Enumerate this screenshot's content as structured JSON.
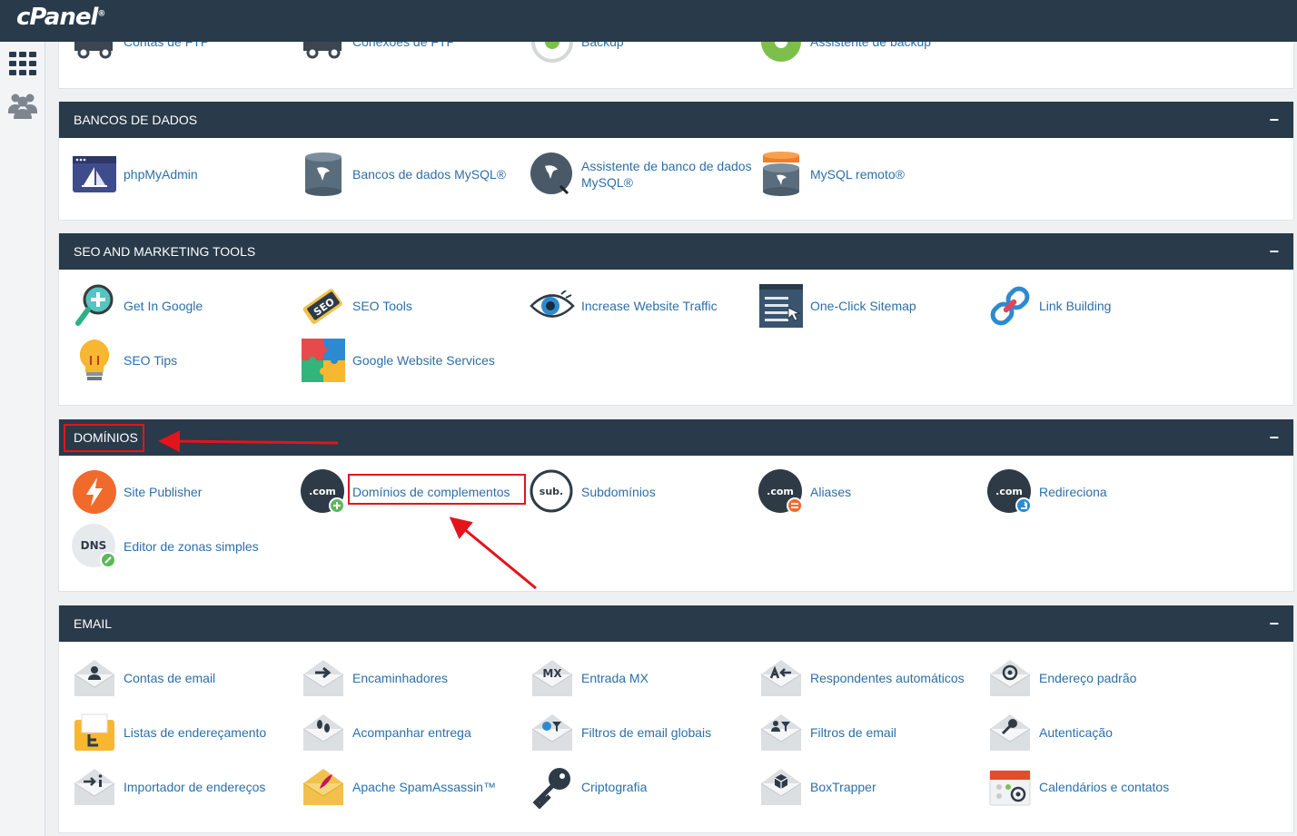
{
  "app": {
    "logo": "cPanel",
    "logo_mark": "®"
  },
  "sidebar": {
    "items": [
      {
        "icon": "grid-icon"
      },
      {
        "icon": "users-icon"
      }
    ]
  },
  "files_panel_partial": {
    "items": [
      {
        "label": "Contas de FTP",
        "icon": "ftp-truck-icon"
      },
      {
        "label": "Conexões de FTP",
        "icon": "ftp-connections-icon"
      },
      {
        "label": "Backup",
        "icon": "backup-icon"
      },
      {
        "label": "Assistente de backup",
        "icon": "backup-wizard-icon"
      }
    ]
  },
  "databases": {
    "title": "BANCOS DE DADOS",
    "collapse": "−",
    "items": [
      {
        "label": "phpMyAdmin",
        "icon": "phpmyadmin-icon"
      },
      {
        "label": "Bancos de dados MySQL®",
        "icon": "mysql-database-icon"
      },
      {
        "label": "Assistente de banco de dados MySQL®",
        "icon": "mysql-wizard-icon"
      },
      {
        "label": "MySQL remoto®",
        "icon": "remote-mysql-icon"
      }
    ]
  },
  "seo": {
    "title": "SEO AND MARKETING TOOLS",
    "collapse": "−",
    "items": [
      {
        "label": "Get In Google",
        "icon": "get-in-google-icon"
      },
      {
        "label": "SEO Tools",
        "icon": "seo-tag-icon"
      },
      {
        "label": "Increase Website Traffic",
        "icon": "eye-icon"
      },
      {
        "label": "One-Click Sitemap",
        "icon": "sitemap-icon"
      },
      {
        "label": "Link Building",
        "icon": "link-icon"
      },
      {
        "label": "SEO Tips",
        "icon": "lightbulb-icon"
      },
      {
        "label": "Google Website Services",
        "icon": "puzzle-icon"
      }
    ]
  },
  "domains": {
    "title": "DOMÍNIOS",
    "collapse": "−",
    "items": [
      {
        "label": "Site Publisher",
        "icon": "site-publisher-icon"
      },
      {
        "label": "Domínios de complementos",
        "icon": "addon-domain-icon",
        "badge": ".com"
      },
      {
        "label": "Subdomínios",
        "icon": "subdomain-icon",
        "badge": "sub."
      },
      {
        "label": "Aliases",
        "icon": "aliases-icon",
        "badge": ".com"
      },
      {
        "label": "Redireciona",
        "icon": "redirects-icon",
        "badge": ".com"
      },
      {
        "label": "Editor de zonas simples",
        "icon": "dns-zone-icon",
        "badge": "DNS"
      }
    ]
  },
  "email": {
    "title": "EMAIL",
    "collapse": "−",
    "items": [
      {
        "label": "Contas de email",
        "icon": "email-accounts-icon"
      },
      {
        "label": "Encaminhadores",
        "icon": "forwarders-icon"
      },
      {
        "label": "Entrada MX",
        "icon": "mx-entry-icon",
        "badge": "MX"
      },
      {
        "label": "Respondentes automáticos",
        "icon": "autoresponders-icon"
      },
      {
        "label": "Endereço padrão",
        "icon": "default-address-icon"
      },
      {
        "label": "Listas de endereçamento",
        "icon": "mailing-lists-icon"
      },
      {
        "label": "Acompanhar entrega",
        "icon": "track-delivery-icon"
      },
      {
        "label": "Filtros de email globais",
        "icon": "global-filters-icon"
      },
      {
        "label": "Filtros de email",
        "icon": "email-filters-icon"
      },
      {
        "label": "Autenticação",
        "icon": "authentication-icon"
      },
      {
        "label": "Importador de endereços",
        "icon": "address-importer-icon"
      },
      {
        "label": "Apache SpamAssassin™",
        "icon": "spamassassin-icon"
      },
      {
        "label": "Criptografia",
        "icon": "encryption-key-icon"
      },
      {
        "label": "BoxTrapper",
        "icon": "boxtrapper-icon"
      },
      {
        "label": "Calendários e contatos",
        "icon": "calendars-contacts-icon"
      }
    ]
  },
  "colors": {
    "header": "#293a4a",
    "link": "#2c6fa8",
    "highlight": "#e3141b"
  }
}
